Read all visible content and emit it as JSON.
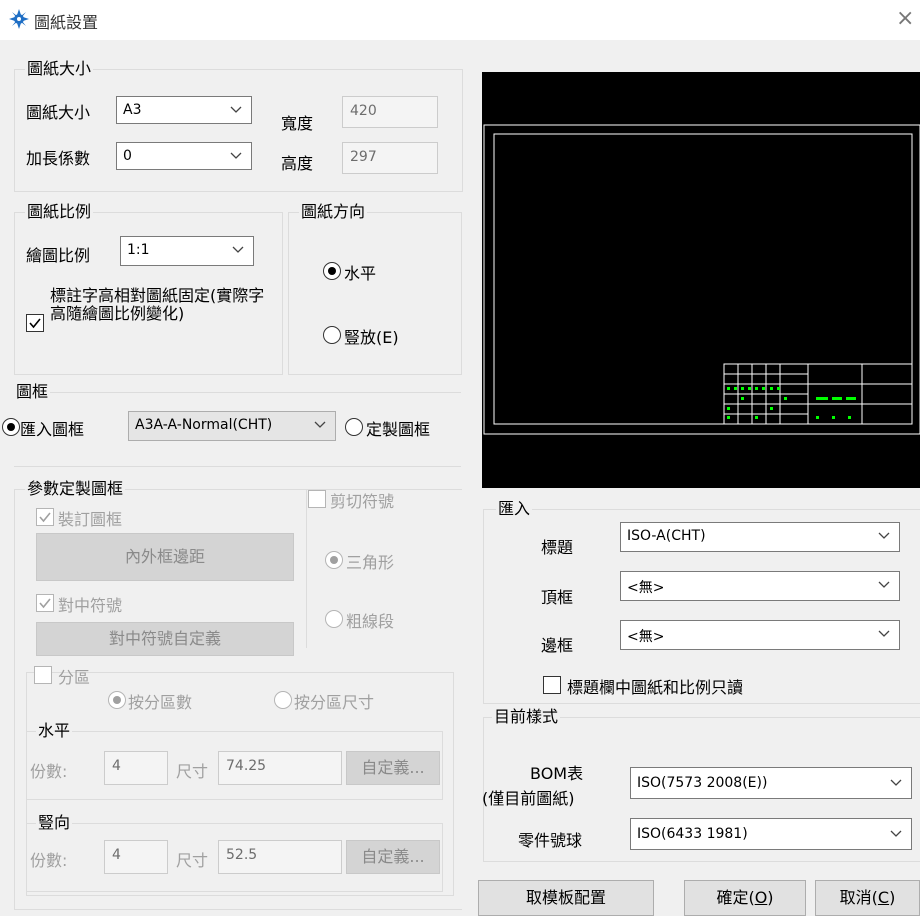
{
  "window": {
    "title": "圖紙設置",
    "close_glyph": "×"
  },
  "paper_size": {
    "group": "圖紙大小",
    "size_label": "圖紙大小",
    "size_value": "A3",
    "ext_label": "加長係數",
    "ext_value": "0",
    "width_label": "寬度",
    "width_value": "420",
    "height_label": "高度",
    "height_value": "297"
  },
  "scale": {
    "group": "圖紙比例",
    "draw_scale_label": "繪圖比例",
    "draw_scale_value": "1:1",
    "fixed_text_label": "標註字高相對圖紙固定(實際字高隨繪圖比例變化)",
    "fixed_text_checked": true
  },
  "orientation": {
    "group": "圖紙方向",
    "horizontal": "水平",
    "vertical": "豎放(E)",
    "selected": "horizontal"
  },
  "frame": {
    "group": "圖框",
    "import_label": "匯入圖框",
    "import_value": "A3A-A-Normal(CHT)",
    "custom_label": "定製圖框",
    "selected": "import"
  },
  "param_frame": {
    "group": "參數定製圖框",
    "binding_label": "裝訂圖框",
    "binding_checked": true,
    "margin_button": "內外框邊距",
    "center_mark_label": "對中符號",
    "center_mark_checked": true,
    "center_custom_button": "對中符號自定義",
    "cut_mark_label": "剪切符號",
    "cut_mark_checked": false,
    "triangle_label": "三角形",
    "thick_line_label": "粗線段",
    "cut_selected": "triangle",
    "zone_label": "分區",
    "zone_checked": false,
    "by_count_label": "按分區數",
    "by_size_label": "按分區尺寸",
    "zone_selected": "by_count",
    "horizontal": {
      "title": "水平",
      "count_label": "份數:",
      "count_value": "4",
      "size_label": "尺寸",
      "size_value": "74.25",
      "custom_button": "自定義..."
    },
    "vertical": {
      "title": "豎向",
      "count_label": "份數:",
      "count_value": "4",
      "size_label": "尺寸",
      "size_value": "52.5",
      "custom_button": "自定義..."
    }
  },
  "import": {
    "group": "匯入",
    "title_label": "標題",
    "title_value": "ISO-A(CHT)",
    "top_label": "頂框",
    "top_value": "<無>",
    "side_label": "邊框",
    "side_value": "<無>",
    "readonly_label": "標題欄中圖紙和比例只讀",
    "readonly_checked": false
  },
  "style": {
    "group": "目前樣式",
    "bom_label_1": "BOM表",
    "bom_label_2": "(僅目前圖紙)",
    "bom_value": "ISO(7573 2008(E))",
    "balloon_label": "零件號球",
    "balloon_value": "ISO(6433 1981)"
  },
  "buttons": {
    "template": "取模板配置",
    "ok": "確定",
    "ok_key": "O",
    "cancel": "取消",
    "cancel_key": "C"
  },
  "colors": {
    "accent_icon": "#1f6fc5",
    "preview_bg": "#000000",
    "preview_line": "#ffffff",
    "preview_green": "#00ff00"
  }
}
